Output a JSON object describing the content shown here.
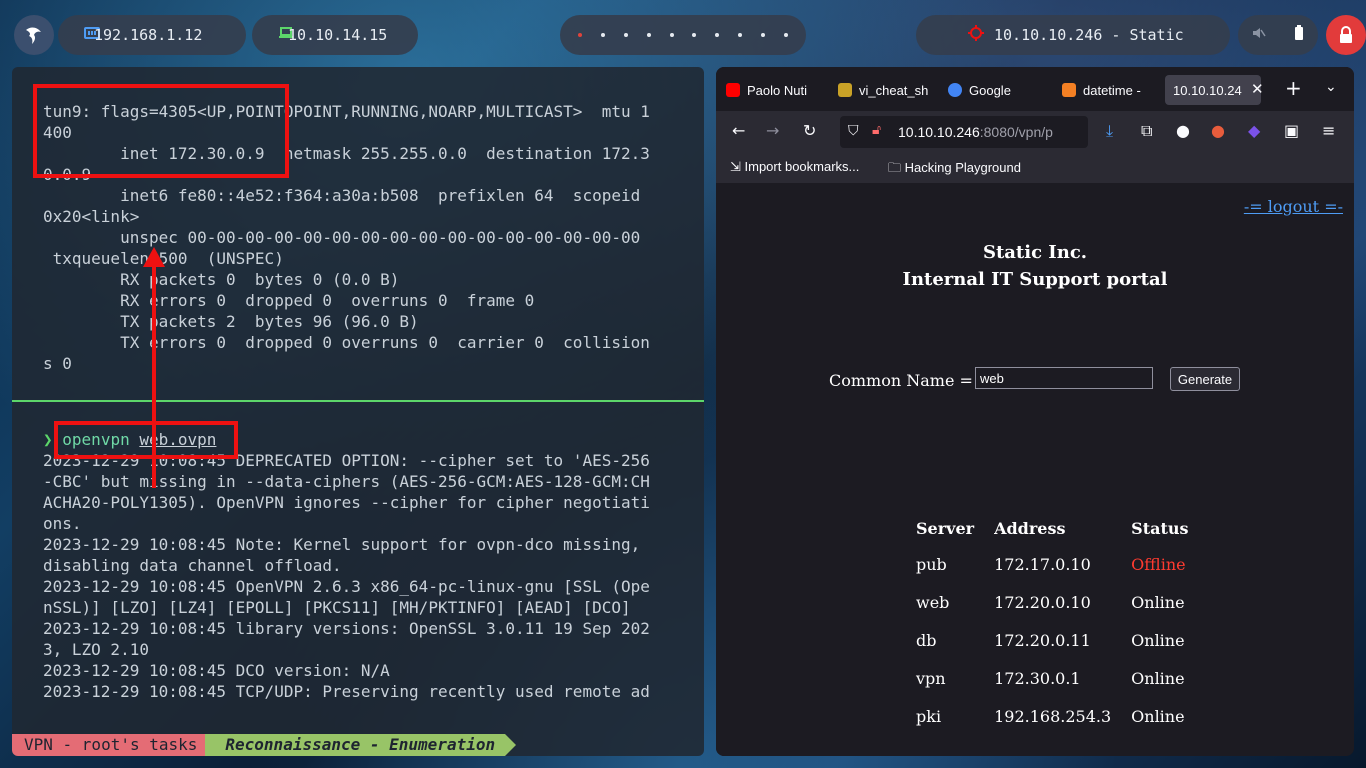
{
  "topbar": {
    "ip_local": "192.168.1.12",
    "ip_vpn": "10.10.14.15",
    "target": "10.10.10.246 - Static",
    "workspaces": 10,
    "active_workspace": 0
  },
  "terminal": {
    "top_lines": [
      "tun9: flags=4305<UP,POINTOPOINT,RUNNING,NOARP,MULTICAST>  mtu 1",
      "400",
      "        inet 172.30.0.9  netmask 255.255.0.0  destination 172.3",
      "0.0.9",
      "        inet6 fe80::4e52:f364:a30a:b508  prefixlen 64  scopeid",
      "0x20<link>",
      "        unspec 00-00-00-00-00-00-00-00-00-00-00-00-00-00-00-00",
      " txqueuelen 500  (UNSPEC)",
      "        RX packets 0  bytes 0 (0.0 B)",
      "        RX errors 0  dropped 0  overruns 0  frame 0",
      "        TX packets 2  bytes 96 (96.0 B)",
      "        TX errors 0  dropped 0 overruns 0  carrier 0  collision",
      "s 0"
    ],
    "prompt_symbol": "❯",
    "command": "openvpn",
    "command_arg": "web.ovpn",
    "bottom_lines": [
      "2023-12-29 10:08:45 DEPRECATED OPTION: --cipher set to 'AES-256",
      "-CBC' but missing in --data-ciphers (AES-256-GCM:AES-128-GCM:CH",
      "ACHA20-POLY1305). OpenVPN ignores --cipher for cipher negotiati",
      "ons.",
      "2023-12-29 10:08:45 Note: Kernel support for ovpn-dco missing,",
      "disabling data channel offload.",
      "2023-12-29 10:08:45 OpenVPN 2.6.3 x86_64-pc-linux-gnu [SSL (Ope",
      "nSSL)] [LZO] [LZ4] [EPOLL] [PKCS11] [MH/PKTINFO] [AEAD] [DCO]",
      "2023-12-29 10:08:45 library versions: OpenSSL 3.0.11 19 Sep 202",
      "3, LZO 2.10",
      "2023-12-29 10:08:45 DCO version: N/A",
      "2023-12-29 10:08:45 TCP/UDP: Preserving recently used remote ad"
    ],
    "status_session": "VPN - root's tasks",
    "status_window": "Reconnaissance - Enumeration"
  },
  "browser": {
    "tabs": [
      {
        "label": "Paolo Nuti",
        "favicon_color": "#ff0000"
      },
      {
        "label": "vi_cheat_sh",
        "favicon_color": "#c9a227"
      },
      {
        "label": "Google",
        "favicon_color": "#4285f4"
      },
      {
        "label": "datetime -",
        "favicon_color": "#f48024"
      },
      {
        "label": "10.10.10.24",
        "favicon_color": "#42414d"
      }
    ],
    "url_host": "10.10.10.246",
    "url_path": ":8080/vpn/p",
    "bookmarks": [
      "Import bookmarks...",
      "Hacking Playground"
    ]
  },
  "page": {
    "logout": "-= logout =-",
    "title_line1": "Static Inc.",
    "title_line2": "Internal IT Support portal",
    "form_label": "Common Name =",
    "input_value": "web",
    "button": "Generate",
    "table_headers": [
      "Server",
      "Address",
      "Status"
    ],
    "rows": [
      {
        "server": "pub",
        "address": "172.17.0.10",
        "status": "Offline"
      },
      {
        "server": "web",
        "address": "172.20.0.10",
        "status": "Online"
      },
      {
        "server": "db",
        "address": "172.20.0.11",
        "status": "Online"
      },
      {
        "server": "vpn",
        "address": "172.30.0.1",
        "status": "Online"
      },
      {
        "server": "pki",
        "address": "192.168.254.3",
        "status": "Online"
      }
    ]
  },
  "colors": {
    "accent_green": "#5cd66a",
    "highlight_red": "#ee1111",
    "offline_red": "#ff3b30",
    "link_blue": "#4e9cf4"
  }
}
